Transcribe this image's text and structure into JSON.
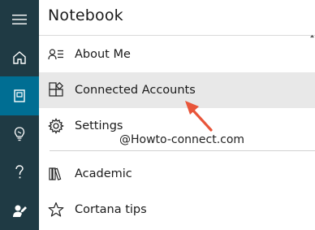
{
  "rail": {
    "items": [
      {
        "icon": "hamburger-icon"
      },
      {
        "icon": "home-icon"
      },
      {
        "icon": "notebook-icon",
        "active": true
      },
      {
        "icon": "lightbulb-icon"
      },
      {
        "icon": "help-icon"
      },
      {
        "icon": "feedback-icon"
      }
    ],
    "colors": {
      "background": "#1f3a44",
      "active": "#006e93"
    }
  },
  "panel": {
    "title": "Notebook",
    "items": [
      {
        "label": "About Me",
        "icon": "about-me-icon"
      },
      {
        "label": "Connected Accounts",
        "icon": "connected-accounts-icon",
        "highlighted": true
      },
      {
        "label": "Settings",
        "icon": "settings-gear-icon"
      },
      {
        "label": "Academic",
        "icon": "books-icon"
      },
      {
        "label": "Cortana tips",
        "icon": "star-icon"
      }
    ]
  },
  "watermark": "@Howto-connect.com",
  "annotation": {
    "arrow_color": "#e8553a"
  }
}
